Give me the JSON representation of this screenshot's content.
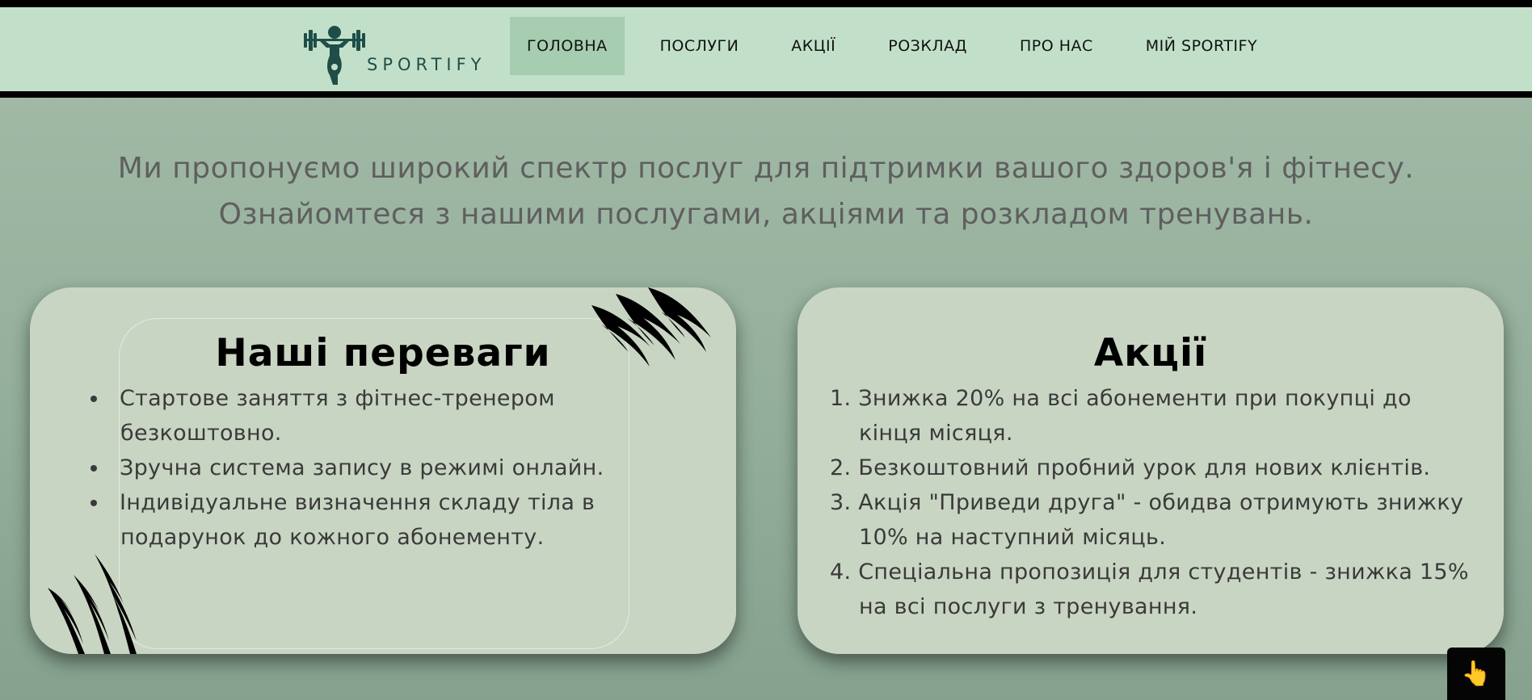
{
  "brand": {
    "name": "SPORTIFY",
    "logo_icon": "weightlifter-icon"
  },
  "nav": {
    "items": [
      {
        "label": "ГОЛОВНА",
        "active": true
      },
      {
        "label": "ПОСЛУГИ",
        "active": false
      },
      {
        "label": "АКЦІЇ",
        "active": false
      },
      {
        "label": "РОЗКЛАД",
        "active": false
      },
      {
        "label": "ПРО НАС",
        "active": false
      },
      {
        "label": "МІЙ SPORTIFY",
        "active": false
      }
    ]
  },
  "intro": {
    "line1": "Ми пропонуємо широкий спектр послуг для підтримки вашого здоров'я і фітнесу.",
    "line2": "Ознайомтеся з нашими послугами, акціями та розкладом тренувань."
  },
  "advantages": {
    "title": "Наші переваги",
    "items": [
      "Стартове заняття з фітнес-тренером безкоштовно.",
      "Зручна система запису в режимі онлайн.",
      "Індивідуальне визначення складу тіла в подарунок до кожного абонементу."
    ]
  },
  "promotions": {
    "title": "Акції",
    "items": [
      "Знижка 20% на всі абонементи при покупці до кінця місяця.",
      "Безкоштовний пробний урок для нових клієнтів.",
      "Акція \"Приведи друга\" - обидва отримують знижку 10% на наступний місяць.",
      "Спеціальна пропозиція для студентів - знижка 15% на всі послуги з тренування."
    ]
  },
  "fab": {
    "icon": "pointing-hand-icon",
    "glyph": "👆"
  },
  "colors": {
    "header_bg": "#c2e0c9",
    "nav_active_bg": "#a6cdaf",
    "page_bg": "#93ae9b",
    "card_bg": "#c9d5c3",
    "logo": "#1f4e48"
  }
}
